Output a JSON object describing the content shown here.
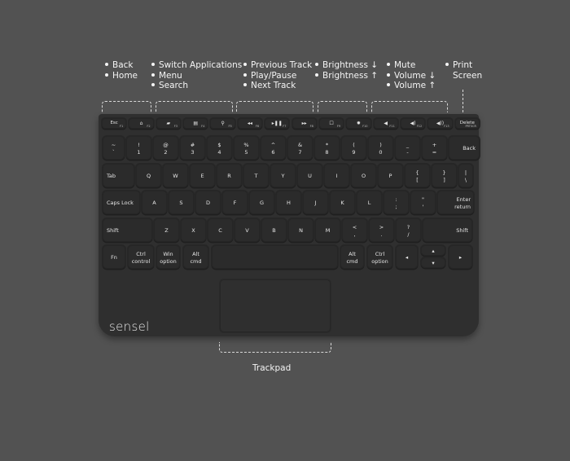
{
  "annotations": [
    {
      "id": "nav",
      "lines": [
        "Back",
        "Home"
      ],
      "bulleted": true
    },
    {
      "id": "apps",
      "lines": [
        "Switch Applications",
        "Menu",
        "Search"
      ],
      "bulleted": true
    },
    {
      "id": "media",
      "lines": [
        "Previous Track",
        "Play/Pause",
        "Next Track"
      ],
      "bulleted": true
    },
    {
      "id": "brightness",
      "lines": [
        "Brightness ↓",
        "Brightness ↑"
      ],
      "bulleted": true
    },
    {
      "id": "volume",
      "lines": [
        "Mute",
        "Volume ↓",
        "Volume ↑"
      ],
      "bulleted": true
    },
    {
      "id": "print",
      "lines": [
        "Print",
        "Screen"
      ],
      "bulleted": true
    }
  ],
  "function_row": [
    {
      "label": "Esc",
      "sub": "F1"
    },
    {
      "label": "⌂",
      "sub": "F2",
      "icon": "home-icon"
    },
    {
      "label": "▰",
      "sub": "F3",
      "icon": "switch-apps-icon"
    },
    {
      "label": "▤",
      "sub": "F4",
      "icon": "menu-icon"
    },
    {
      "label": "⚲",
      "sub": "F5",
      "icon": "search-icon"
    },
    {
      "label": "◂◂",
      "sub": "F6",
      "icon": "previous-track-icon"
    },
    {
      "label": "▸❚❚",
      "sub": "F7",
      "icon": "play-pause-icon"
    },
    {
      "label": "▸▸",
      "sub": "F8",
      "icon": "next-track-icon"
    },
    {
      "label": "☐",
      "sub": "F9",
      "icon": "brightness-down-icon"
    },
    {
      "label": "✹",
      "sub": "F10",
      "icon": "brightness-up-icon"
    },
    {
      "label": "◀",
      "sub": "F11",
      "icon": "mute-icon"
    },
    {
      "label": "◀)",
      "sub": "F12",
      "icon": "volume-down-icon"
    },
    {
      "label": "◀))",
      "sub": "F13",
      "icon": "volume-up-icon"
    },
    {
      "label": "Delete",
      "sub": "PRTSCR"
    }
  ],
  "number_row": [
    {
      "top": "~",
      "bottom": "`"
    },
    {
      "top": "!",
      "bottom": "1"
    },
    {
      "top": "@",
      "bottom": "2"
    },
    {
      "top": "#",
      "bottom": "3"
    },
    {
      "top": "$",
      "bottom": "4"
    },
    {
      "top": "%",
      "bottom": "5"
    },
    {
      "top": "^",
      "bottom": "6"
    },
    {
      "top": "&",
      "bottom": "7"
    },
    {
      "top": "*",
      "bottom": "8"
    },
    {
      "top": "(",
      "bottom": "9"
    },
    {
      "top": ")",
      "bottom": "0"
    },
    {
      "top": "_",
      "bottom": "-"
    },
    {
      "top": "+",
      "bottom": "="
    },
    {
      "top": "Back",
      "bottom": ""
    }
  ],
  "qwerty_row": [
    {
      "top": "Tab"
    },
    {
      "top": "Q"
    },
    {
      "top": "W"
    },
    {
      "top": "E"
    },
    {
      "top": "R"
    },
    {
      "top": "T"
    },
    {
      "top": "Y"
    },
    {
      "top": "U"
    },
    {
      "top": "I"
    },
    {
      "top": "O"
    },
    {
      "top": "P"
    },
    {
      "top": "{",
      "bottom": "["
    },
    {
      "top": "}",
      "bottom": "]"
    },
    {
      "top": "|",
      "bottom": "\\"
    }
  ],
  "home_row": [
    {
      "top": "Caps Lock"
    },
    {
      "top": "A"
    },
    {
      "top": "S"
    },
    {
      "top": "D"
    },
    {
      "top": "F"
    },
    {
      "top": "G"
    },
    {
      "top": "H"
    },
    {
      "top": "J"
    },
    {
      "top": "K"
    },
    {
      "top": "L"
    },
    {
      "top": ":",
      "bottom": ";"
    },
    {
      "top": "\"",
      "bottom": "'"
    },
    {
      "top": "Enter",
      "bottom": "return"
    }
  ],
  "shift_row": [
    {
      "top": "Shift"
    },
    {
      "top": "Z"
    },
    {
      "top": "X"
    },
    {
      "top": "C"
    },
    {
      "top": "V"
    },
    {
      "top": "B"
    },
    {
      "top": "N"
    },
    {
      "top": "M"
    },
    {
      "top": "<",
      "bottom": ","
    },
    {
      "top": ">",
      "bottom": "."
    },
    {
      "top": "?",
      "bottom": "/"
    },
    {
      "top": "Shift"
    }
  ],
  "bottom_row": [
    {
      "top": "Fn"
    },
    {
      "top": "Ctrl",
      "bottom": "control"
    },
    {
      "top": "Win",
      "bottom": "option"
    },
    {
      "top": "Alt",
      "bottom": "cmd"
    },
    {
      "top": ""
    },
    {
      "top": "Alt",
      "bottom": "cmd"
    },
    {
      "top": "Ctrl",
      "bottom": "option"
    },
    {
      "top": "◂"
    },
    {
      "top": "▴"
    },
    {
      "top": "▾"
    },
    {
      "top": "▸"
    }
  ],
  "brand": "sensel",
  "trackpad_label": "Trackpad"
}
